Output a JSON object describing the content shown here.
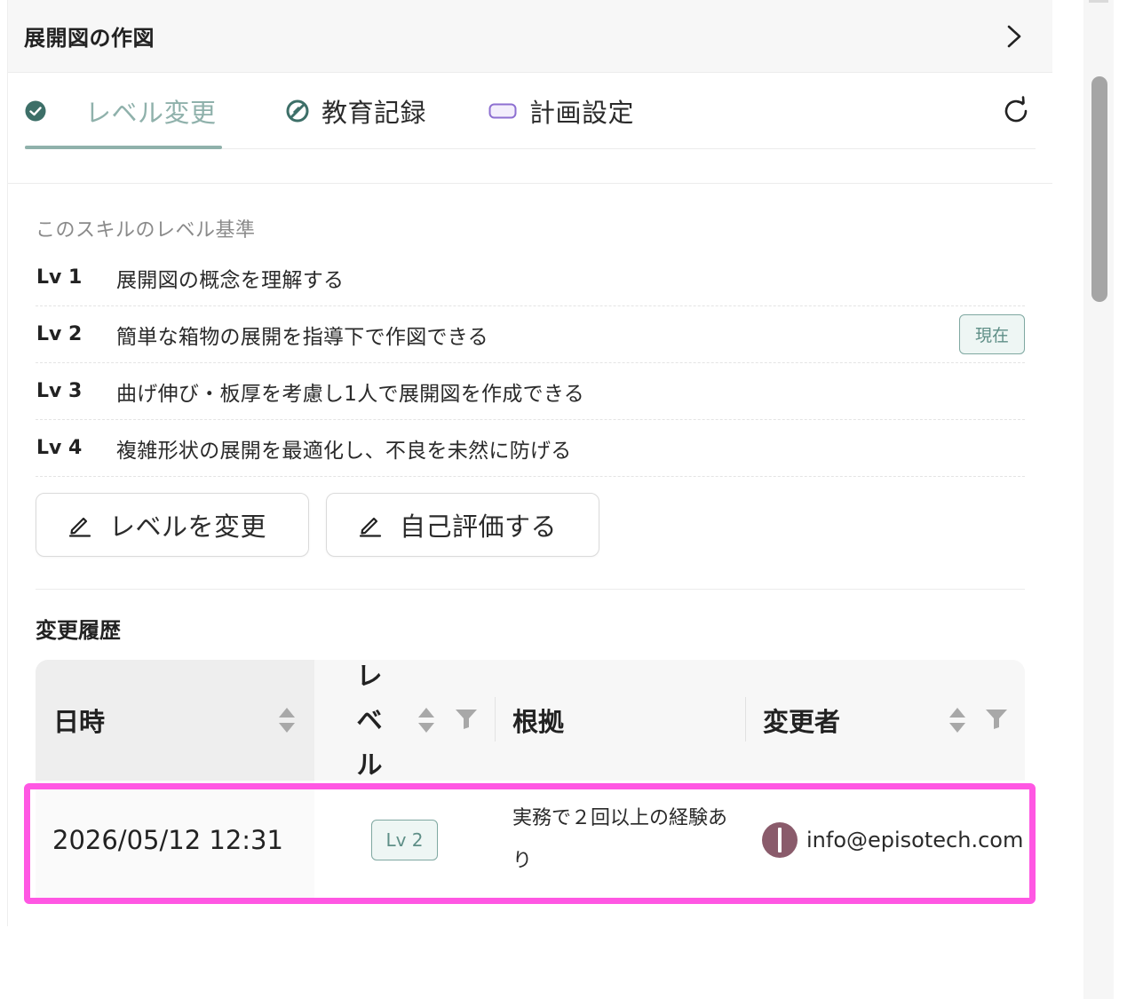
{
  "header": {
    "title": "展開図の作図"
  },
  "tabs": [
    {
      "label": "レベル変更",
      "icon": "check-circle-icon",
      "active": true
    },
    {
      "label": "教育記録",
      "icon": "slash-circle-icon",
      "active": false
    },
    {
      "label": "計画設定",
      "icon": "rounded-rect-icon",
      "active": false
    }
  ],
  "criteria": {
    "title": "このスキルのレベル基準",
    "current_badge": "現在",
    "current_level_index": 1,
    "levels": [
      {
        "lv": "Lv 1",
        "desc": "展開図の概念を理解する"
      },
      {
        "lv": "Lv 2",
        "desc": "簡単な箱物の展開を指導下で作図できる"
      },
      {
        "lv": "Lv 3",
        "desc": "曲げ伸び・板厚を考慮し1人で展開図を作成できる"
      },
      {
        "lv": "Lv 4",
        "desc": "複雑形状の展開を最適化し、不良を未然に防げる"
      }
    ]
  },
  "actions": {
    "change_level": "レベルを変更",
    "self_assess": "自己評価する"
  },
  "history": {
    "title": "変更履歴",
    "columns": {
      "date": "日時",
      "level": "レベル",
      "reason": "根拠",
      "user": "変更者"
    },
    "rows": [
      {
        "date": "2026/05/12 12:31",
        "level": "Lv 2",
        "reason": "実務で２回以上の経験あり",
        "user": "info@episotech.com"
      }
    ]
  },
  "colors": {
    "accent": "#8fb1ab",
    "badge_border": "#7fa8a1",
    "highlight": "#ff57e3",
    "avatar": "#8a5b6b"
  }
}
